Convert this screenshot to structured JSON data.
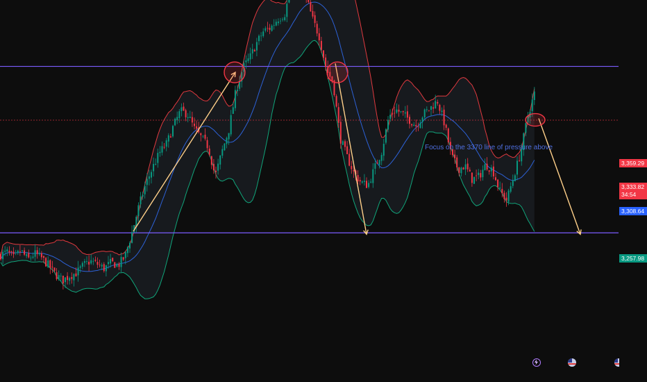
{
  "chart_data": {
    "type": "candlestick",
    "instrument_note": "Focus on the 3370 line of pressure above",
    "y_range": [
      3195,
      3410
    ],
    "price_tags": [
      {
        "label": "3,359.29",
        "value": 3359.29,
        "color": "#f23645"
      },
      {
        "label": "3,333.82",
        "sublabel": "34:54",
        "value": 3333.82,
        "color": "#f23645"
      },
      {
        "label": "3,308.64",
        "value": 3308.64,
        "color": "#2962ff"
      },
      {
        "label": "3,257.98",
        "value": 3257.98,
        "color": "#089981"
      }
    ],
    "horizontal_lines": [
      {
        "name": "resistance-line",
        "value": 3370,
        "color": "#7b5cff"
      },
      {
        "name": "support-line",
        "value": 3257.98,
        "color": "#7b5cff"
      },
      {
        "name": "current-price-line",
        "value": 3333.82,
        "color": "#f23645",
        "dashed": true
      }
    ],
    "close_path": [
      [
        0,
        3243
      ],
      [
        10,
        3245
      ],
      [
        20,
        3241
      ],
      [
        30,
        3246
      ],
      [
        40,
        3240
      ],
      [
        50,
        3244
      ],
      [
        60,
        3241
      ],
      [
        70,
        3236
      ],
      [
        80,
        3230
      ],
      [
        90,
        3226
      ],
      [
        100,
        3229
      ],
      [
        110,
        3231
      ],
      [
        120,
        3236
      ],
      [
        130,
        3239
      ],
      [
        140,
        3237
      ],
      [
        150,
        3234
      ],
      [
        160,
        3238
      ],
      [
        170,
        3236
      ],
      [
        180,
        3242
      ],
      [
        190,
        3258
      ],
      [
        200,
        3276
      ],
      [
        210,
        3291
      ],
      [
        220,
        3302
      ],
      [
        230,
        3312
      ],
      [
        240,
        3318
      ],
      [
        250,
        3330
      ],
      [
        260,
        3340
      ],
      [
        270,
        3338
      ],
      [
        280,
        3328
      ],
      [
        290,
        3322
      ],
      [
        300,
        3316
      ],
      [
        310,
        3296
      ],
      [
        320,
        3313
      ],
      [
        330,
        3328
      ],
      [
        340,
        3354
      ],
      [
        350,
        3369
      ],
      [
        360,
        3376
      ],
      [
        370,
        3386
      ],
      [
        380,
        3394
      ],
      [
        390,
        3396
      ],
      [
        400,
        3402
      ],
      [
        410,
        3405
      ],
      [
        420,
        3425
      ],
      [
        430,
        3432
      ],
      [
        440,
        3418
      ],
      [
        450,
        3402
      ],
      [
        460,
        3390
      ],
      [
        470,
        3368
      ],
      [
        480,
        3359
      ],
      [
        490,
        3322
      ],
      [
        500,
        3309
      ],
      [
        510,
        3298
      ],
      [
        520,
        3292
      ],
      [
        530,
        3290
      ],
      [
        540,
        3302
      ],
      [
        550,
        3313
      ],
      [
        560,
        3336
      ],
      [
        570,
        3341
      ],
      [
        580,
        3338
      ],
      [
        590,
        3334
      ],
      [
        600,
        3330
      ],
      [
        610,
        3338
      ],
      [
        620,
        3342
      ],
      [
        630,
        3347
      ],
      [
        640,
        3332
      ],
      [
        650,
        3310
      ],
      [
        660,
        3301
      ],
      [
        670,
        3303
      ],
      [
        680,
        3294
      ],
      [
        690,
        3296
      ],
      [
        700,
        3304
      ],
      [
        710,
        3300
      ],
      [
        720,
        3286
      ],
      [
        730,
        3280
      ],
      [
        740,
        3296
      ],
      [
        750,
        3312
      ],
      [
        760,
        3336
      ],
      [
        770,
        3352
      ]
    ],
    "arrows": [
      {
        "from": [
          192,
          3259
        ],
        "to": [
          339,
          3366
        ],
        "color": "#ffd08a"
      },
      {
        "from": [
          483,
          3372
        ],
        "to": [
          528,
          3257
        ],
        "color": "#ffd08a"
      },
      {
        "from": [
          776,
          3335
        ],
        "to": [
          836,
          3257
        ],
        "color": "#ffd08a"
      }
    ],
    "highlight_circles": [
      {
        "name": "breakout-circle",
        "x": 338,
        "value": 3366,
        "color": "#f23645"
      },
      {
        "name": "rejection-circle",
        "x": 486,
        "value": 3366,
        "color": "#f23645"
      },
      {
        "name": "current-circle",
        "x": 771,
        "value": 3334,
        "color": "#f23645"
      }
    ],
    "indicator": "Bollinger Bands",
    "grid": false,
    "colors": {
      "background": "#0d0d0d",
      "up_candle": "#089981",
      "down_candle": "#f23645",
      "upper_band": "#e0393f",
      "middle_band": "#2d62d8",
      "lower_band": "#10a57a",
      "band_fill": "#1b1f24"
    }
  },
  "footer_icons": [
    "lightning-icon",
    "flag-icon",
    "flag-icon-2"
  ]
}
